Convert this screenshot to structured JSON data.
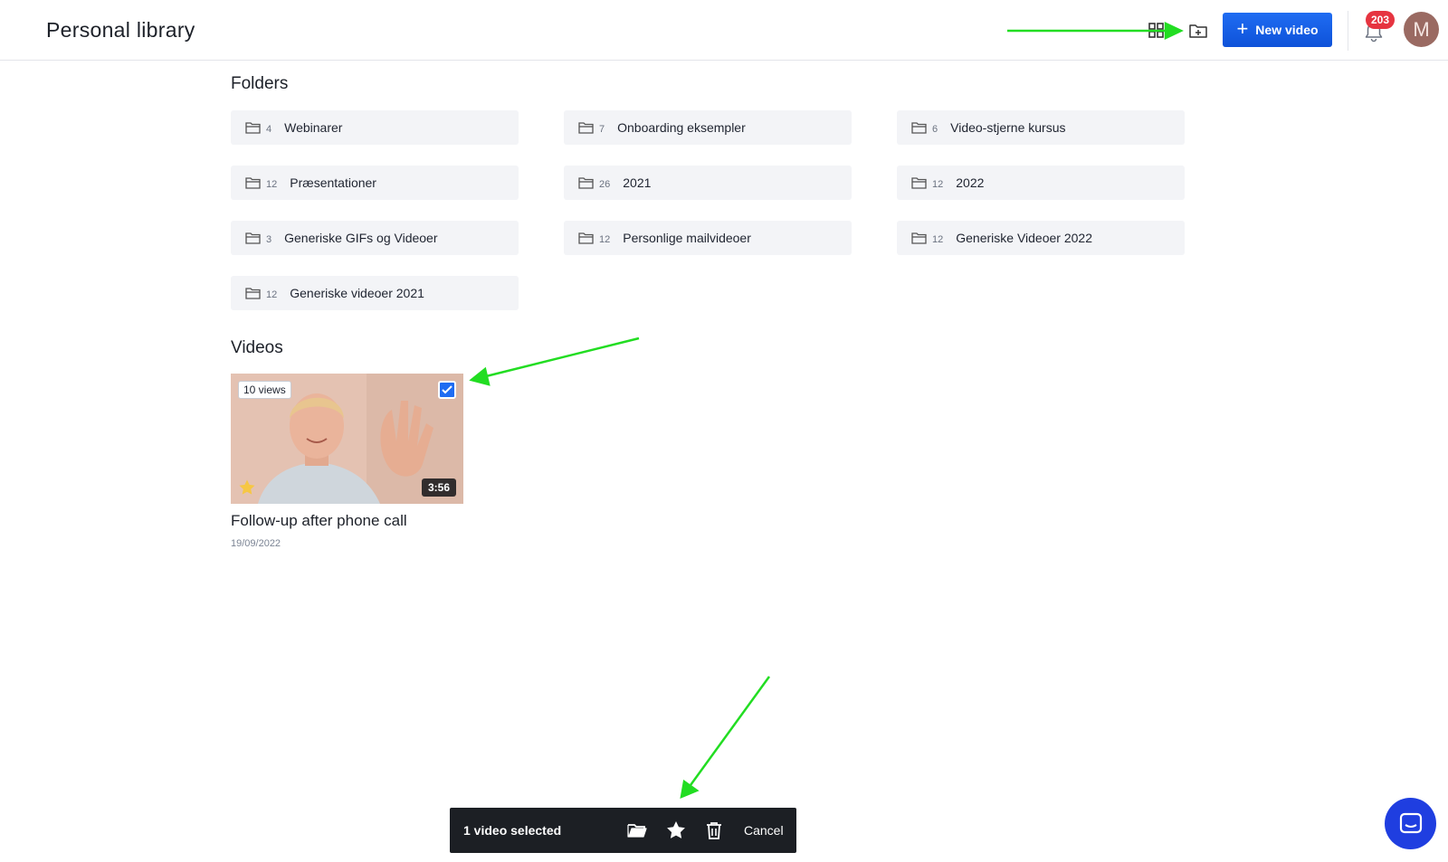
{
  "header": {
    "title": "Personal library",
    "new_video_label": "New video",
    "notification_count": "203",
    "avatar_initial": "M"
  },
  "folders_section": {
    "title": "Folders",
    "items": [
      {
        "count": "4",
        "name": "Webinarer"
      },
      {
        "count": "7",
        "name": "Onboarding eksempler"
      },
      {
        "count": "6",
        "name": "Video-stjerne kursus"
      },
      {
        "count": "12",
        "name": "Præsentationer"
      },
      {
        "count": "26",
        "name": "2021"
      },
      {
        "count": "12",
        "name": "2022"
      },
      {
        "count": "3",
        "name": "Generiske GIFs og Videoer"
      },
      {
        "count": "12",
        "name": "Personlige mailvideoer"
      },
      {
        "count": "12",
        "name": "Generiske Videoer 2022"
      },
      {
        "count": "12",
        "name": "Generiske videoer 2021"
      }
    ]
  },
  "videos_section": {
    "title": "Videos",
    "items": [
      {
        "views": "10 views",
        "duration": "3:56",
        "title": "Follow-up after phone call",
        "date": "19/09/2022",
        "selected": true,
        "favorite": true
      }
    ]
  },
  "selection_bar": {
    "label": "1 video selected",
    "cancel_label": "Cancel",
    "actions": [
      "folder-open-icon",
      "star-icon",
      "trash-icon"
    ]
  },
  "colors": {
    "accent": "#1f6cf2",
    "badge": "#e63440",
    "annotation_arrow": "#22dd22",
    "folder_bg": "#f3f4f7",
    "selection_bar_bg": "#1c1f24",
    "chat_button": "#1f3ee0"
  }
}
